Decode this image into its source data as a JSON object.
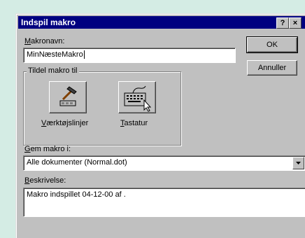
{
  "dialog": {
    "title": "Indspil makro",
    "help_button": "?",
    "close_button": "×"
  },
  "macro_name": {
    "label_key": "M",
    "label_rest": "akronavn:",
    "value": "MinNæsteMakro"
  },
  "assign": {
    "group_label": "Tildel makro til",
    "toolbars_key": "V",
    "toolbars_rest": "ærktøjslinjer",
    "keyboard_key": "T",
    "keyboard_rest": "astatur"
  },
  "store": {
    "label_key": "G",
    "label_rest": "em makro i:",
    "value": "Alle dokumenter (Normal.dot)"
  },
  "description": {
    "label_key": "B",
    "label_rest": "eskrivelse:",
    "value": "Makro indspillet 04-12-00 af ."
  },
  "buttons": {
    "ok": "OK",
    "cancel": "Annuller"
  },
  "colors": {
    "titlebar": "#000080",
    "face": "#c0c0c0",
    "desktop": "#d4ece4"
  },
  "icons": {
    "toolbars": "hammer-toolbar-icon",
    "keyboard": "keyboard-icon"
  }
}
